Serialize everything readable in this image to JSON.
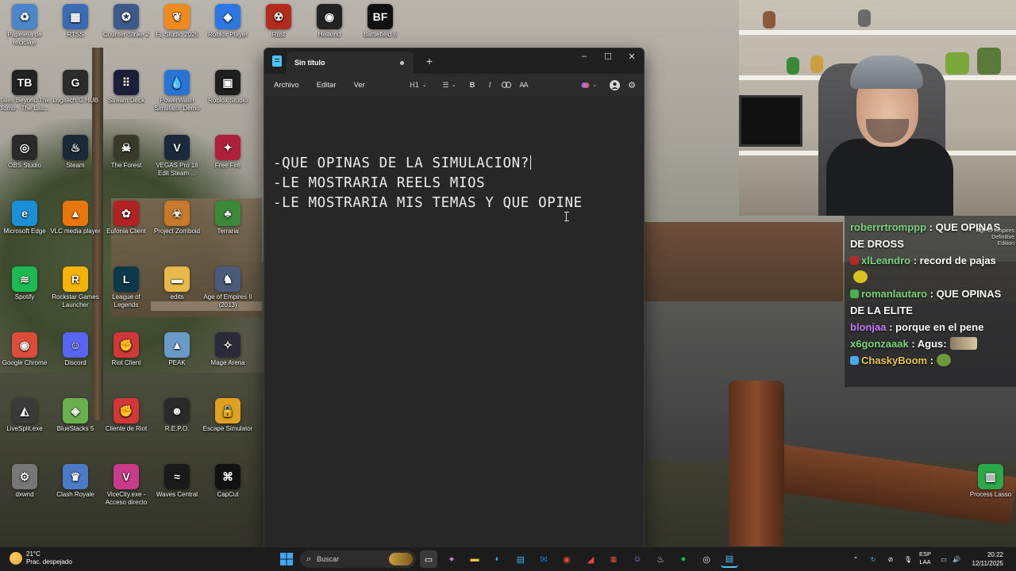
{
  "desktop": {
    "icons": [
      {
        "label": "Papelera de reciclaje",
        "icon": "recycle-bin-icon",
        "color": "#4a86c8",
        "glyph": "♻"
      },
      {
        "label": "RTSS",
        "icon": "rtss-icon",
        "color": "#3b6bb5",
        "glyph": "▦"
      },
      {
        "label": "Counter-Strike 2",
        "icon": "counter-strike-icon",
        "color": "#3e5a8a",
        "glyph": "✪"
      },
      {
        "label": "FL Studio 2025",
        "icon": "fl-studio-icon",
        "color": "#f08a1c",
        "glyph": "❦"
      },
      {
        "label": "Roblox Player",
        "icon": "roblox-icon",
        "color": "#2b78e4",
        "glyph": "◆"
      },
      {
        "label": "Rust",
        "icon": "rust-icon",
        "color": "#b32a1f",
        "glyph": "☢"
      },
      {
        "label": "Hellkind",
        "icon": "hellkind-icon",
        "color": "#222222",
        "glyph": "◉"
      },
      {
        "label": "Battlefield 6",
        "icon": "battlefield-icon",
        "color": "#111111",
        "glyph": "BF"
      },
      {
        "label": "Tales Beyond The Tomb - The Las...",
        "icon": "tales-beyond-icon",
        "color": "#222222",
        "glyph": "TB"
      },
      {
        "label": "Logitech G HUB",
        "icon": "logitech-icon",
        "color": "#2b2b2b",
        "glyph": "G"
      },
      {
        "label": "Stream Deck",
        "icon": "stream-deck-icon",
        "color": "#1b1f3b",
        "glyph": "⠿"
      },
      {
        "label": "PowerWash Simulator Demo",
        "icon": "powerwash-icon",
        "color": "#2a73d6",
        "glyph": "💧"
      },
      {
        "label": "Roblox Studio",
        "icon": "roblox-studio-icon",
        "color": "#1e1e1e",
        "glyph": "▣"
      },
      {
        "label": "OBS Studio",
        "icon": "obs-icon",
        "color": "#2a2a2a",
        "glyph": "◎"
      },
      {
        "label": "Steam",
        "icon": "steam-icon",
        "color": "#1b2838",
        "glyph": "♨"
      },
      {
        "label": "The Forest",
        "icon": "the-forest-icon",
        "color": "#3a3a2a",
        "glyph": "☠"
      },
      {
        "label": "VEGAS Pro 18 Edit Steam ...",
        "icon": "vegas-icon",
        "color": "#1a2a3a",
        "glyph": "V"
      },
      {
        "label": "Free Fire",
        "icon": "free-fire-icon",
        "color": "#b0203a",
        "glyph": "✦"
      },
      {
        "label": "Microsoft Edge",
        "icon": "edge-icon",
        "color": "#1b8fd6",
        "glyph": "e"
      },
      {
        "label": "VLC media player",
        "icon": "vlc-icon",
        "color": "#e8760a",
        "glyph": "▲"
      },
      {
        "label": "Eufonia Client",
        "icon": "eufonia-icon",
        "color": "#b22222",
        "glyph": "✿"
      },
      {
        "label": "Project Zomboid",
        "icon": "project-zomboid-icon",
        "color": "#c87a2a",
        "glyph": "☣"
      },
      {
        "label": "Terraria",
        "icon": "terraria-icon",
        "color": "#3a8a3a",
        "glyph": "♣"
      },
      {
        "label": "Spotify",
        "icon": "spotify-icon",
        "color": "#1db954",
        "glyph": "≋"
      },
      {
        "label": "Rockstar Games Launcher",
        "icon": "rockstar-icon",
        "color": "#f5b400",
        "glyph": "R"
      },
      {
        "label": "League of Legends",
        "icon": "league-icon",
        "color": "#0a3a4a",
        "glyph": "L"
      },
      {
        "label": "edits",
        "icon": "folder-icon",
        "color": "#e8b94a",
        "glyph": "▬"
      },
      {
        "label": "Age of Empires II (2013)",
        "icon": "age-of-empires-icon",
        "color": "#4a5a7a",
        "glyph": "♞"
      },
      {
        "label": "Google Chrome",
        "icon": "chrome-icon",
        "color": "#dd4b39",
        "glyph": "◉"
      },
      {
        "label": "Discord",
        "icon": "discord-icon",
        "color": "#5865f2",
        "glyph": "☺"
      },
      {
        "label": "Riot Client",
        "icon": "riot-client-icon",
        "color": "#d13639",
        "glyph": "✊"
      },
      {
        "label": "PEAK",
        "icon": "peak-icon",
        "color": "#6a9ac8",
        "glyph": "▲"
      },
      {
        "label": "Mage Arena",
        "icon": "mage-arena-icon",
        "color": "#2a2a3a",
        "glyph": "✧"
      },
      {
        "label": "LiveSplit.exe",
        "icon": "livesplit-icon",
        "color": "#3a3a3a",
        "glyph": "◭"
      },
      {
        "label": "BlueStacks 5",
        "icon": "bluestacks-icon",
        "color": "#6ab04c",
        "glyph": "◈"
      },
      {
        "label": "Cliente de Riot",
        "icon": "riot-cliente-icon",
        "color": "#d13639",
        "glyph": "✊"
      },
      {
        "label": "R.E.P.O.",
        "icon": "repo-icon",
        "color": "#2a2a2a",
        "glyph": "☻"
      },
      {
        "label": "Escape Simulator",
        "icon": "escape-simulator-icon",
        "color": "#e0a020",
        "glyph": "🔒"
      },
      {
        "label": "dxwnd",
        "icon": "dxwnd-icon",
        "color": "#777777",
        "glyph": "⚙"
      },
      {
        "label": "Clash Royale",
        "icon": "clash-royale-icon",
        "color": "#4a7ac8",
        "glyph": "♛"
      },
      {
        "label": "ViceCity.exe - Acceso directo",
        "icon": "vicecity-icon",
        "color": "#c83a8a",
        "glyph": "V"
      },
      {
        "label": "Waves Central",
        "icon": "waves-icon",
        "color": "#1a1a1a",
        "glyph": "≈"
      },
      {
        "label": "CapCut",
        "icon": "capcut-icon",
        "color": "#111111",
        "glyph": "⌘"
      },
      {
        "label": "Process Lasso",
        "icon": "process-lasso-icon",
        "color": "#2aa84a",
        "glyph": "▥"
      }
    ]
  },
  "notepad": {
    "tab_title": "Sin título",
    "menu": [
      "Archivo",
      "Editar",
      "Ver"
    ],
    "heading_label": "H1",
    "lines": [
      "-QUE OPINAS DE LA SIMULACION?",
      "-LE MOSTRARIA REELS MIOS",
      "-LE MOSTRARIA MIS TEMAS Y QUE OPINE"
    ]
  },
  "chat": {
    "messages": [
      {
        "user": "roberrrtromppp",
        "user_color": "#7cd67c",
        "text": " : QUE OPINAS DE DROSS",
        "badge": null
      },
      {
        "user": "xlLeandro",
        "user_color": "#7cd67c",
        "text": " : record de pajas",
        "badge": "#b42a2a"
      },
      {
        "user": "romanlautaro",
        "user_color": "#7cd67c",
        "text": " : QUE OPINAS DE LA ELITE",
        "badge": "#4caf50"
      },
      {
        "user": "blonjaa",
        "user_color": "#c77dff",
        "text": " : porque en el pene",
        "badge": null
      },
      {
        "user": "x6gonzaaak",
        "user_color": "#7cd67c",
        "text": " : Agus:",
        "badge": null
      },
      {
        "user": "ChaskyBoom",
        "user_color": "#e8c547",
        "text": " :",
        "badge": "#4aa8f0"
      }
    ],
    "overlay_tag": "Age of Empires Definitive Edition"
  },
  "taskbar": {
    "weather_temp": "21°C",
    "weather_desc": "Prac. despejado",
    "search_placeholder": "Buscar",
    "lang_top": "ESP",
    "lang_bottom": "LAA",
    "time": "20:22",
    "date": "12/11/2025"
  }
}
